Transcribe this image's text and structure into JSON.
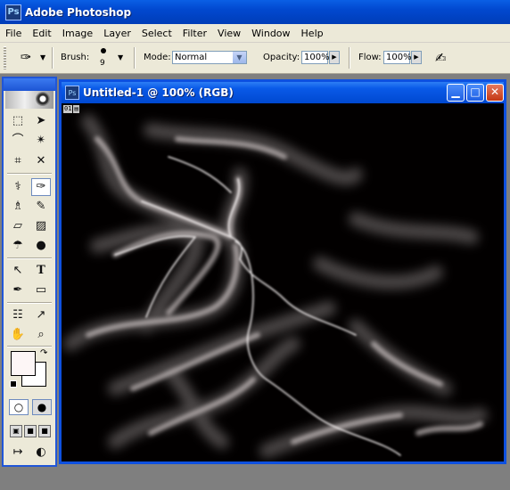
{
  "app": {
    "title": "Adobe Photoshop",
    "icon": "photoshop-icon"
  },
  "menu": [
    "File",
    "Edit",
    "Image",
    "Layer",
    "Select",
    "Filter",
    "View",
    "Window",
    "Help"
  ],
  "options": {
    "brush_label": "Brush:",
    "brush_size": "9",
    "mode_label": "Mode:",
    "mode_value": "Normal",
    "opacity_label": "Opacity:",
    "opacity_value": "100%",
    "flow_label": "Flow:",
    "flow_value": "100%"
  },
  "document": {
    "title": "Untitled-1 @ 100% (RGB)",
    "badge_left": "01",
    "background_color": "#020000",
    "stroke_color": "#ffffff"
  },
  "toolbox": {
    "active_tool": "brush-tool",
    "foreground_color": "#fdf6f6",
    "background_color": "#ffffff"
  },
  "colors": {
    "xp_blue": "#0055e5",
    "menu_bg": "#ece9d8",
    "desktop": "#7f7f7f"
  }
}
